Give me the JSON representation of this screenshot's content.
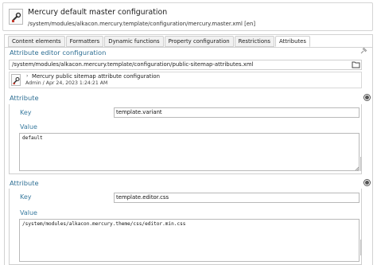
{
  "header": {
    "title": "Mercury default master configuration",
    "path": "/system/modules/alkacon.mercury.template/configuration/mercury.master.xml [en]",
    "icon": "wrench-icon"
  },
  "tabs": [
    {
      "label": "Content elements",
      "active": false
    },
    {
      "label": "Formatters",
      "active": false
    },
    {
      "label": "Dynamic functions",
      "active": false
    },
    {
      "label": "Property configuration",
      "active": false
    },
    {
      "label": "Restrictions",
      "active": false
    },
    {
      "label": "Attributes",
      "active": true
    }
  ],
  "editor_config": {
    "title": "Attribute editor configuration",
    "path_value": "/system/modules/alkacon.mercury.template/configuration/public-sitemap-attributes.xml",
    "resource": {
      "title": "Mercury public sitemap attribute configuration",
      "meta": "Admin / Apr 24, 2023 1:24:21 AM"
    }
  },
  "attributes": [
    {
      "section_title": "Attribute",
      "key_label": "Key",
      "key_value": "template.variant",
      "value_label": "Value",
      "value_text": "default"
    },
    {
      "section_title": "Attribute",
      "key_label": "Key",
      "key_value": "template.editor.css",
      "value_label": "Value",
      "value_text": "/system/modules/alkacon.mercury.theme/css/editor.min.css"
    }
  ],
  "colors": {
    "section_title": "#2f6f94",
    "field_label": "#3b7ca0",
    "border": "#cfcfcf"
  }
}
